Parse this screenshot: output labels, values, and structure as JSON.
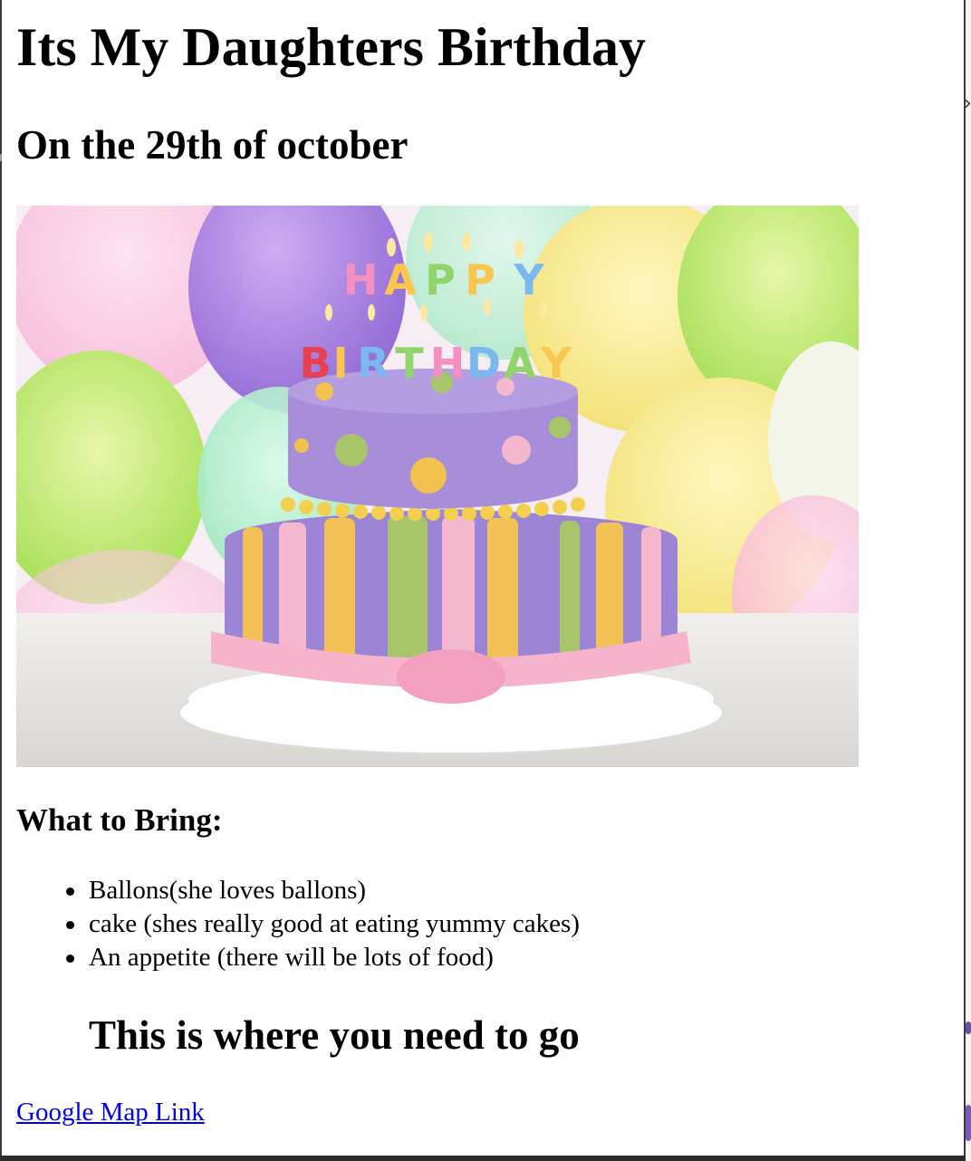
{
  "page": {
    "title": "Its My Daughters Birthday",
    "subtitle": "On the 29th of october"
  },
  "image": {
    "icon": "birthday-cake-photo",
    "cake_text_top": "HAPPY",
    "cake_text_bottom": "BIRTHDAY"
  },
  "bring": {
    "heading": "What to Bring:",
    "items": [
      "Ballons(she loves ballons)",
      "cake (shes really good at eating yummy cakes)",
      "An appetite (there will be lots of food)"
    ]
  },
  "directions": {
    "heading": "This is where you need to go",
    "link_text": "Google Map Link"
  },
  "colors": {
    "link": "#0000ee",
    "text": "#000000",
    "background": "#ffffff"
  }
}
